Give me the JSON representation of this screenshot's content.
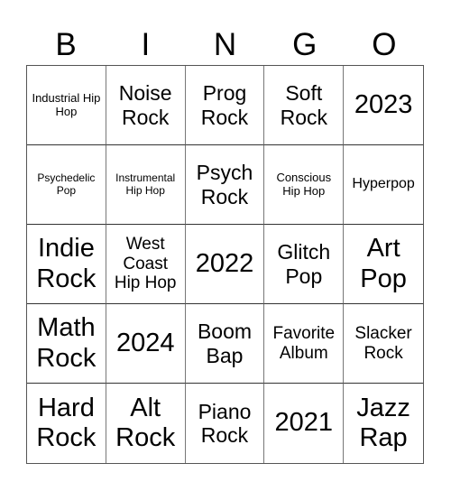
{
  "header": [
    "B",
    "I",
    "N",
    "G",
    "O"
  ],
  "cells": [
    "Industrial Hip Hop",
    "Noise Rock",
    "Prog Rock",
    "Soft Rock",
    "2023",
    "Psychedelic Pop",
    "Instrumental Hip Hop",
    "Psych Rock",
    "Conscious Hip Hop",
    "Hyperpop",
    "Indie Rock",
    "West Coast Hip Hop",
    "2022",
    "Glitch Pop",
    "Art Pop",
    "Math Rock",
    "2024",
    "Boom Bap",
    "Favorite Album",
    "Slacker Rock",
    "Hard Rock",
    "Alt Rock",
    "Piano Rock",
    "2021",
    "Jazz Rap"
  ]
}
